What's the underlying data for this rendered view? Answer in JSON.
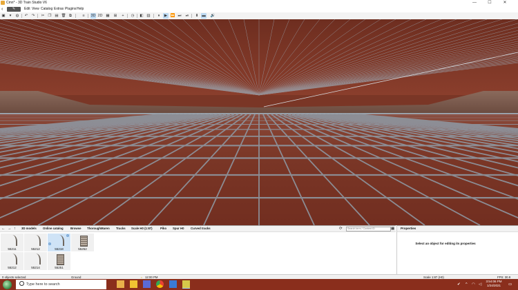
{
  "window": {
    "title": "Cmn* - 3D Train Studio V6",
    "controls": [
      "—",
      "☐",
      "✕"
    ]
  },
  "menubar": {
    "mode_label": "✎",
    "items": [
      "Edit",
      "View",
      "Catalog",
      "Extras",
      "Plugins",
      "Help"
    ]
  },
  "toolbar": {
    "view_3d": "3D",
    "view_2d": "2D"
  },
  "catalog": {
    "breadcrumb": [
      "3D models",
      "Online catalog",
      "Browse",
      "ThoroughMaren",
      "Tracks",
      "Scale H0 (1:87)",
      "Piko",
      "Spur H0",
      "Curved tracks"
    ],
    "search_placeholder": "Search term / Content ID",
    "items": [
      {
        "num": "55211",
        "kind": "curve"
      },
      {
        "num": "55212",
        "kind": "curve"
      },
      {
        "num": "55218",
        "kind": "curve",
        "selected": true
      },
      {
        "num": "55252",
        "kind": "straight"
      },
      {
        "num": "55212",
        "kind": "curve"
      },
      {
        "num": "55214",
        "kind": "curve"
      },
      {
        "num": "55251",
        "kind": "straight"
      }
    ]
  },
  "properties": {
    "header": "Properties",
    "hint": "Select an object for editing its properties"
  },
  "statusbar": {
    "selection": "0 objects selected",
    "surface": "Ground",
    "clock": "12:00 PM",
    "scale": "Scale 1:87 (H0)",
    "fps": "FPS: 30.9"
  },
  "taskbar": {
    "search_placeholder": "Type here to search",
    "time": "3:54:06 PM",
    "date": "1/24/2021"
  },
  "colors": {
    "brick": "#7a3626",
    "grout": "#8e96a0",
    "taskbar": "#8a2e1c",
    "selected_tool": "#bcd9f2"
  }
}
